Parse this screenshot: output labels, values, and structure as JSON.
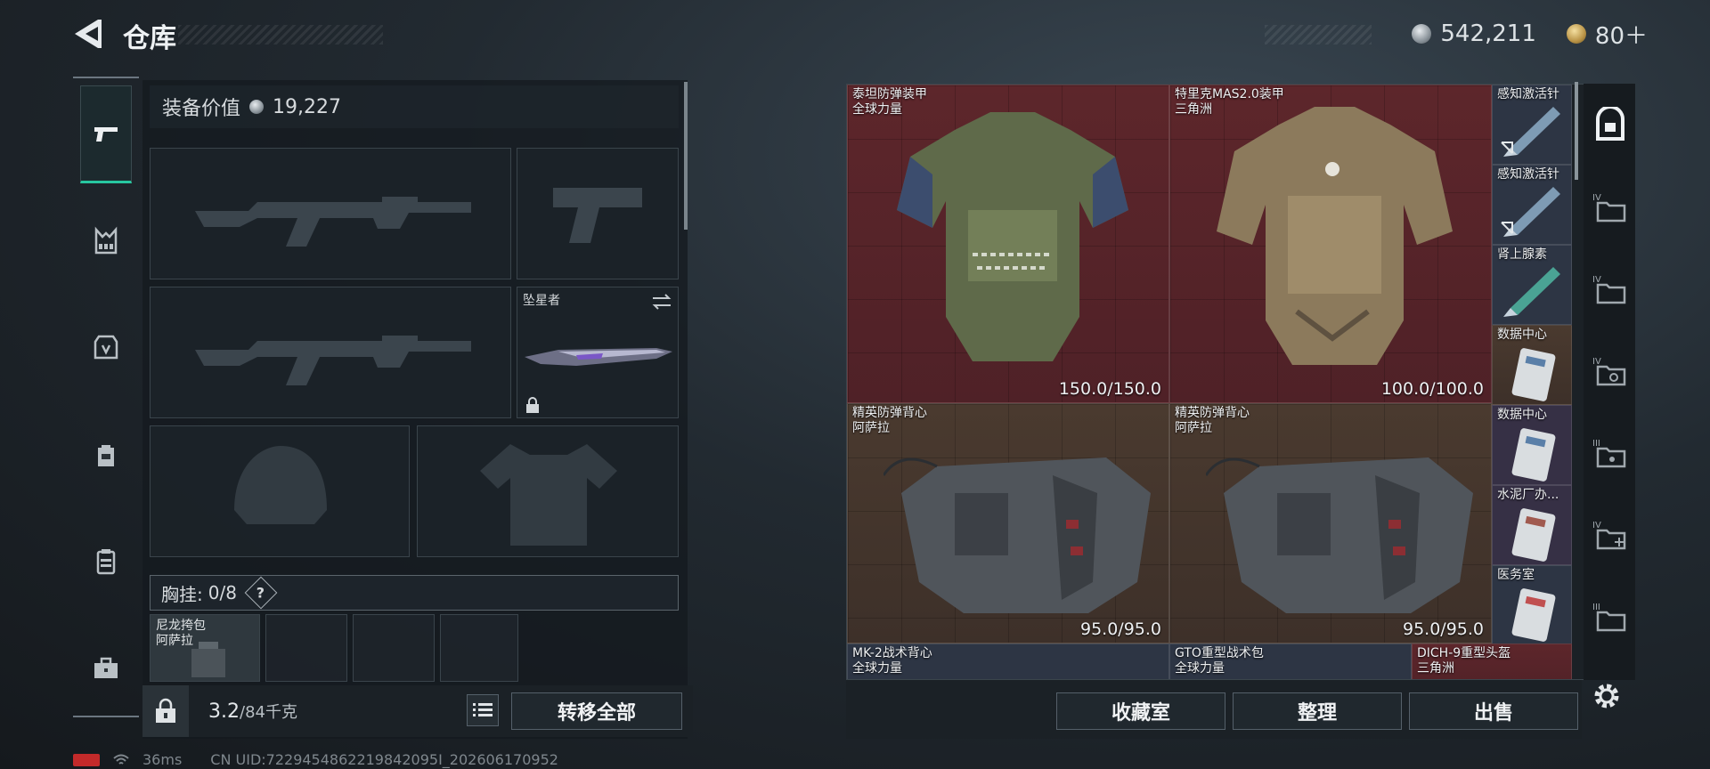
{
  "header": {
    "title": "仓库",
    "currency_silver": "542,211",
    "currency_gold": "80＋"
  },
  "left_rail": {
    "items": [
      {
        "name": "weapons",
        "active": true
      },
      {
        "name": "vest"
      },
      {
        "name": "armor"
      },
      {
        "name": "backpack"
      },
      {
        "name": "container"
      },
      {
        "name": "toolbox"
      }
    ]
  },
  "loadout": {
    "value_label": "装备价值",
    "value": "19,227",
    "melee_label": "坠星者",
    "chest_rig_label": "胸挂:",
    "chest_rig_count": "0/8",
    "help": "?",
    "pouch": {
      "name": "尼龙挎包",
      "maker": "阿萨拉"
    },
    "weight_current": "3.2",
    "weight_max": "/84千克",
    "transfer_all": "转移全部"
  },
  "stash": {
    "items": [
      {
        "id": "armor1",
        "name": "泰坦防弹装甲",
        "maker": "全球力量",
        "durability": "150.0/150.0",
        "rarity": "red"
      },
      {
        "id": "armor2",
        "name": "特里克MAS2.0装甲",
        "maker": "三角洲",
        "durability": "100.0/100.0",
        "rarity": "red"
      },
      {
        "id": "vest1",
        "name": "精英防弹背心",
        "maker": "阿萨拉",
        "durability": "95.0/95.0",
        "rarity": "brown"
      },
      {
        "id": "vest2",
        "name": "精英防弹背心",
        "maker": "阿萨拉",
        "durability": "95.0/95.0",
        "rarity": "brown"
      },
      {
        "id": "inj1",
        "name": "感知激活针",
        "rarity": "blue"
      },
      {
        "id": "inj2",
        "name": "感知激活针",
        "rarity": "blue"
      },
      {
        "id": "inj3",
        "name": "肾上腺素",
        "rarity": "blue"
      },
      {
        "id": "card1",
        "name": "数据中心",
        "rarity": "brown"
      },
      {
        "id": "card2",
        "name": "数据中心",
        "rarity": "purple"
      },
      {
        "id": "card3",
        "name": "水泥厂办...",
        "rarity": "purple"
      },
      {
        "id": "card4",
        "name": "医务室",
        "rarity": "blue"
      },
      {
        "id": "mk2",
        "name": "MK-2战术背心",
        "maker": "全球力量",
        "rarity": "blue"
      },
      {
        "id": "gto",
        "name": "GTO重型战术包",
        "maker": "全球力量",
        "rarity": "blue"
      },
      {
        "id": "dich",
        "name": "DICH-9重型头盔",
        "maker": "三角洲",
        "rarity": "red"
      }
    ],
    "buttons": {
      "collection": "收藏室",
      "organize": "整理",
      "sell": "出售"
    }
  },
  "right_rail": {
    "items": [
      {
        "name": "stash-main"
      },
      {
        "name": "stash-iv-1",
        "tier": "IV"
      },
      {
        "name": "stash-iv-2",
        "tier": "IV"
      },
      {
        "name": "stash-iv-3",
        "tier": "IV"
      },
      {
        "name": "stash-iii-1",
        "tier": "III"
      },
      {
        "name": "stash-iv-4",
        "tier": "IV"
      },
      {
        "name": "stash-iii-2",
        "tier": "III"
      }
    ]
  },
  "status": {
    "ping": "36ms",
    "uid": "CN UID:7229454862219842095I_202606170952"
  },
  "colors": {
    "accent": "#27c6a0",
    "rarity_red": "#5d262b",
    "rarity_brown": "#4a3a2f",
    "rarity_purple": "#363045",
    "rarity_blue": "#2d3544",
    "battery_low": "#c32a2a"
  }
}
